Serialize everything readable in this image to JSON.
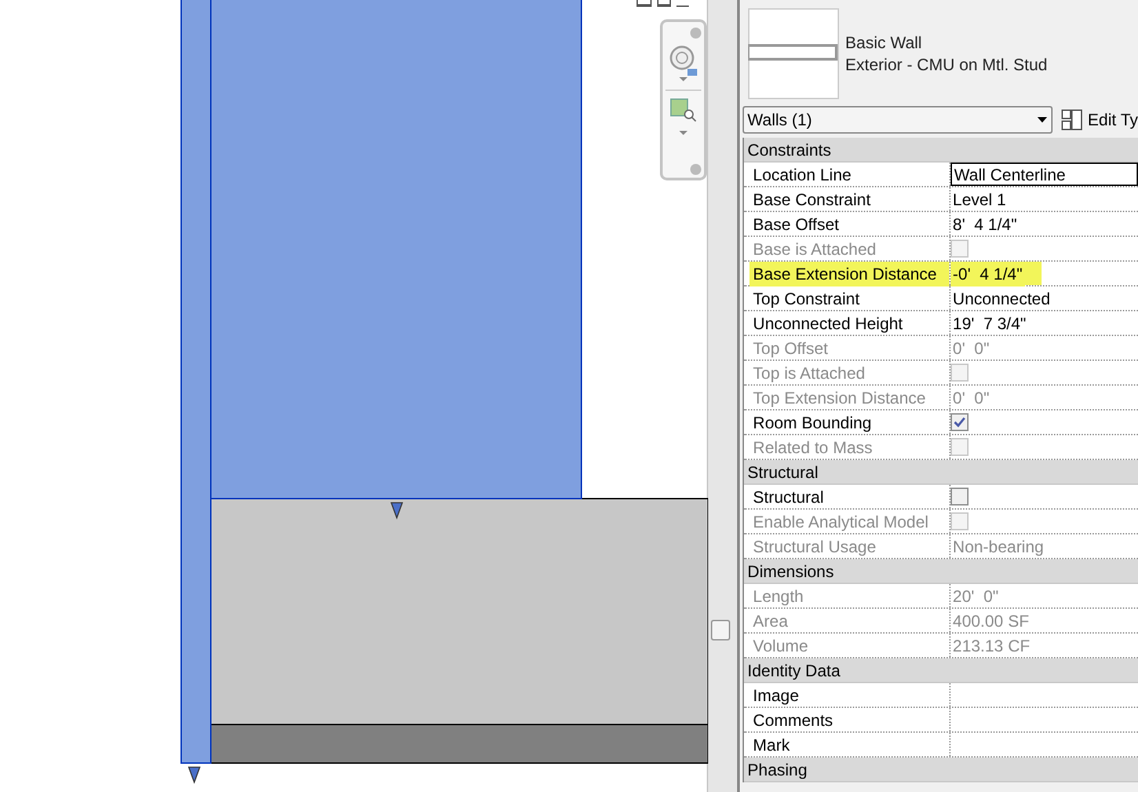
{
  "type_selector": {
    "family": "Basic Wall",
    "type": "Exterior - CMU on Mtl. Stud"
  },
  "instance_filter": {
    "value": "Walls (1)"
  },
  "edit_type_button": {
    "label": "Edit Ty"
  },
  "groups": [
    {
      "title": "Constraints",
      "rows": [
        {
          "name": "Location Line",
          "value": "Wall Centerline",
          "kind": "dropdown",
          "disabled": false,
          "highlighted": false
        },
        {
          "name": "Base Constraint",
          "value": "Level 1",
          "kind": "text",
          "disabled": false,
          "highlighted": false
        },
        {
          "name": "Base Offset",
          "value": "8'  4 1/4\"",
          "kind": "text",
          "disabled": false,
          "highlighted": false
        },
        {
          "name": "Base is Attached",
          "kind": "checkbox",
          "checked": false,
          "disabled": true,
          "highlighted": false
        },
        {
          "name": "Base Extension Distance",
          "value": "-0'  4 1/4\"",
          "kind": "text",
          "disabled": false,
          "highlighted": true
        },
        {
          "name": "Top Constraint",
          "value": "Unconnected",
          "kind": "text",
          "disabled": false,
          "highlighted": false
        },
        {
          "name": "Unconnected Height",
          "value": "19'  7 3/4\"",
          "kind": "text",
          "disabled": false,
          "highlighted": false
        },
        {
          "name": "Top Offset",
          "value": "0'  0\"",
          "kind": "text",
          "disabled": true,
          "highlighted": false
        },
        {
          "name": "Top is Attached",
          "kind": "checkbox",
          "checked": false,
          "disabled": true,
          "highlighted": false
        },
        {
          "name": "Top Extension Distance",
          "value": "0'  0\"",
          "kind": "text",
          "disabled": true,
          "highlighted": false
        },
        {
          "name": "Room Bounding",
          "kind": "checkbox",
          "checked": true,
          "disabled": false,
          "highlighted": false
        },
        {
          "name": "Related to Mass",
          "kind": "checkbox",
          "checked": false,
          "disabled": true,
          "highlighted": false
        }
      ]
    },
    {
      "title": "Structural",
      "rows": [
        {
          "name": "Structural",
          "kind": "checkbox",
          "checked": false,
          "disabled": false,
          "highlighted": false
        },
        {
          "name": "Enable Analytical Model",
          "kind": "checkbox",
          "checked": false,
          "disabled": true,
          "highlighted": false
        },
        {
          "name": "Structural Usage",
          "value": "Non-bearing",
          "kind": "text",
          "disabled": true,
          "highlighted": false
        }
      ]
    },
    {
      "title": "Dimensions",
      "rows": [
        {
          "name": "Length",
          "value": "20'  0\"",
          "kind": "text",
          "disabled": true,
          "highlighted": false
        },
        {
          "name": "Area",
          "value": "400.00 SF",
          "kind": "text",
          "disabled": true,
          "highlighted": false
        },
        {
          "name": "Volume",
          "value": "213.13 CF",
          "kind": "text",
          "disabled": true,
          "highlighted": false
        }
      ]
    },
    {
      "title": "Identity Data",
      "rows": [
        {
          "name": "Image",
          "kind": "text",
          "disabled": false,
          "highlighted": false
        },
        {
          "name": "Comments",
          "kind": "text",
          "disabled": false,
          "highlighted": false
        },
        {
          "name": "Mark",
          "kind": "text",
          "disabled": false,
          "highlighted": false
        }
      ]
    },
    {
      "title": "Phasing"
    }
  ]
}
